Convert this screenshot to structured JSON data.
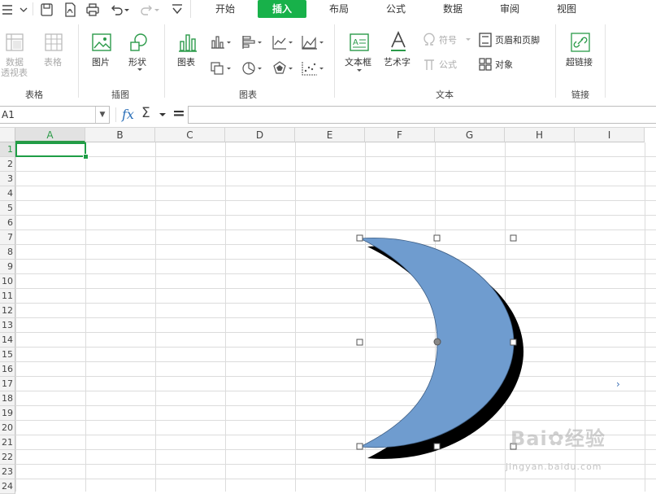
{
  "quick_access": {
    "menu_icon": "hamburger-menu-icon",
    "icons": [
      "save-icon",
      "export-pdf-icon",
      "print-icon",
      "undo-icon",
      "redo-icon",
      "customize-icon"
    ]
  },
  "menu_tabs": [
    {
      "label": "开始",
      "active": false
    },
    {
      "label": "插入",
      "active": true
    },
    {
      "label": "布局",
      "active": false
    },
    {
      "label": "公式",
      "active": false
    },
    {
      "label": "数据",
      "active": false
    },
    {
      "label": "审阅",
      "active": false
    },
    {
      "label": "视图",
      "active": false
    }
  ],
  "ribbon": {
    "tables_group": {
      "pivot_label_1": "数据",
      "pivot_label_2": "透视表",
      "table_label": "表格",
      "group_label": "表格"
    },
    "illustrations_group": {
      "picture_label": "图片",
      "shapes_label": "形状",
      "group_label": "插图"
    },
    "charts_group": {
      "chart_label": "图表",
      "group_label": "图表"
    },
    "text_group": {
      "textbox_label": "文本框",
      "wordart_label": "艺术字",
      "symbol_label": "符号",
      "equation_label": "公式",
      "header_footer_label": "页眉和页脚",
      "object_label": "对象",
      "group_label": "文本"
    },
    "links_group": {
      "hyperlink_label": "超链接",
      "group_label": "链接"
    }
  },
  "formula_bar": {
    "name_box": "A1",
    "fx_label": "fx",
    "sum_label": "Σ",
    "equals_label": "=",
    "value": ""
  },
  "sheet": {
    "columns": [
      "A",
      "B",
      "C",
      "D",
      "E",
      "F",
      "G",
      "H",
      "I"
    ],
    "rows": [
      "1",
      "2",
      "3",
      "4",
      "5",
      "6",
      "7",
      "8",
      "9",
      "10",
      "11",
      "12",
      "13",
      "14",
      "15",
      "16",
      "17",
      "18",
      "19",
      "20",
      "21",
      "22",
      "23",
      "24"
    ],
    "selected_cell": "A1",
    "shape": {
      "type": "moon",
      "fill": "#6f9ccf",
      "shadow": "#000000"
    }
  },
  "watermark": {
    "brand": "Bai",
    "brand_cn": "经验",
    "url": "jingyan.baidu.com"
  },
  "colors": {
    "accent": "#18b14a",
    "selection": "#1e9e46"
  }
}
